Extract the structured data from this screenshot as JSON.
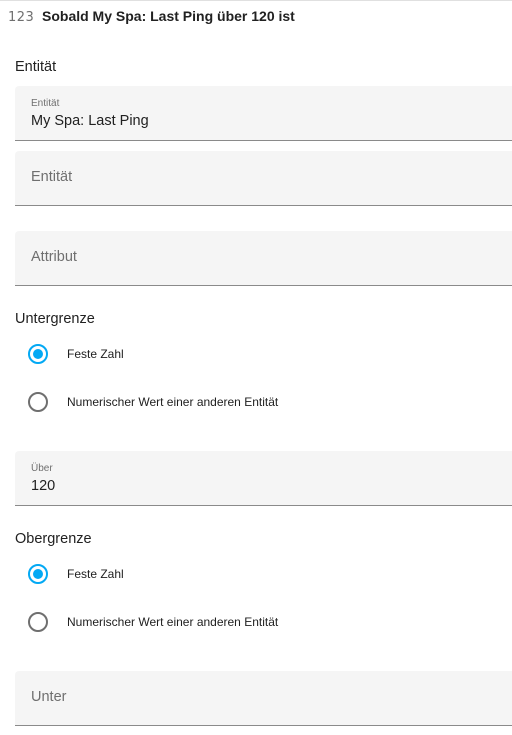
{
  "header": {
    "icon": "numeric-icon",
    "icon_glyph": "123",
    "title": "Sobald My Spa: Last Ping über 120 ist"
  },
  "entity_section": {
    "label": "Entität",
    "entity_field": {
      "label": "Entität",
      "value": "My Spa: Last Ping"
    },
    "entity_field_empty": {
      "placeholder": "Entität"
    },
    "attribute_field": {
      "placeholder": "Attribut"
    }
  },
  "lower_bound": {
    "label": "Untergrenze",
    "options": [
      {
        "label": "Feste Zahl",
        "checked": true
      },
      {
        "label": "Numerischer Wert einer anderen Entität",
        "checked": false
      }
    ],
    "field": {
      "label": "Über",
      "value": "120"
    }
  },
  "upper_bound": {
    "label": "Obergrenze",
    "options": [
      {
        "label": "Feste Zahl",
        "checked": true
      },
      {
        "label": "Numerischer Wert einer anderen Entität",
        "checked": false
      }
    ],
    "field": {
      "placeholder": "Unter"
    }
  },
  "colors": {
    "accent": "#03a9f4",
    "field_background": "#f5f5f5",
    "text": "#212121",
    "secondary_text": "#6f6f6f"
  }
}
